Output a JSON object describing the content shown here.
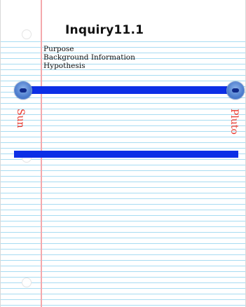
{
  "notebook": {
    "title": "Inquiry11.1",
    "sections": [
      {
        "label": "Purpose"
      },
      {
        "label": "Background Information"
      },
      {
        "label": "Hypothesis"
      }
    ]
  },
  "slider": {
    "left_label": "Sun",
    "right_label": "Pluto",
    "track_color": "#0c2fe6",
    "knob_color": "#5a88d6"
  },
  "colors": {
    "rule_line": "#a8dcf2",
    "margin_line": "#f4a9ad",
    "label_text": "#e8342a"
  }
}
